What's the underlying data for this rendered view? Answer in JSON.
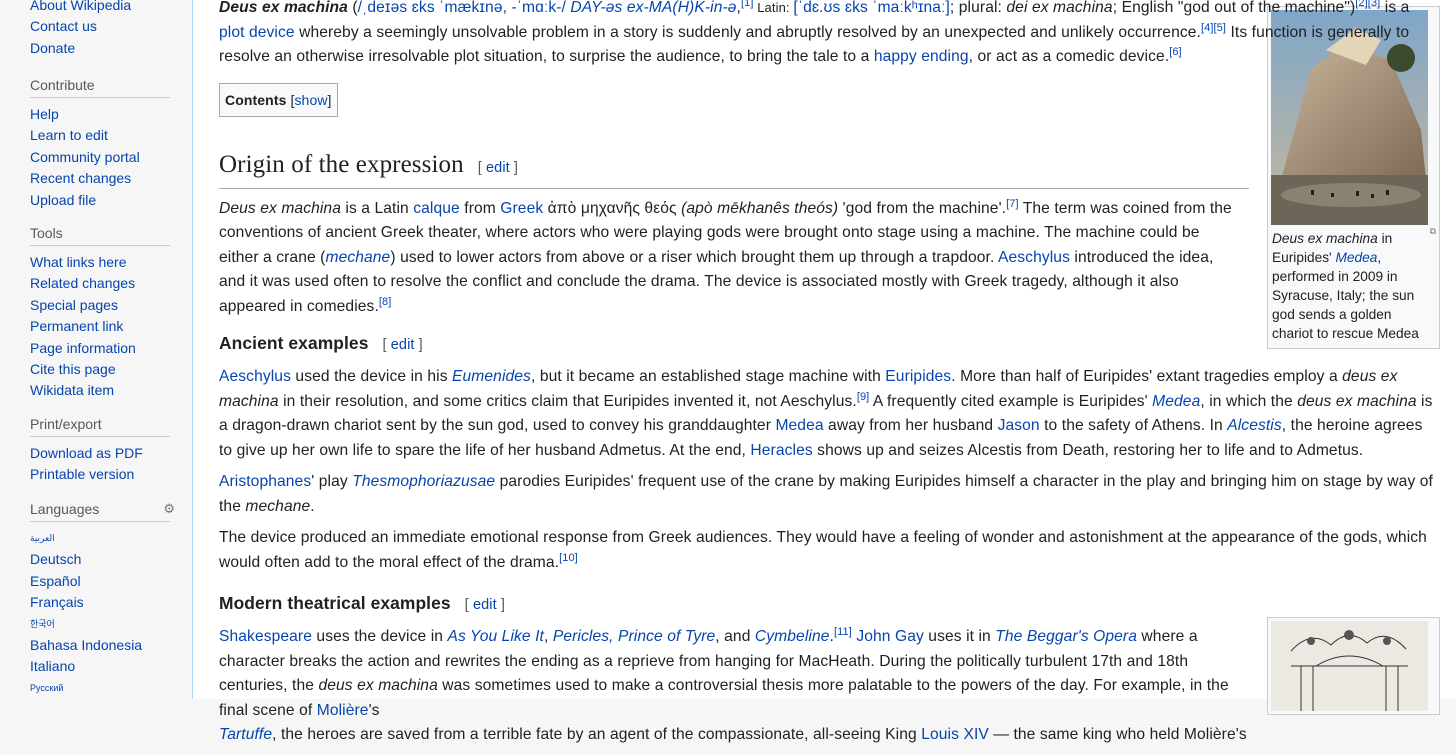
{
  "sidebar": {
    "nav_items": [
      "About Wikipedia",
      "Contact us",
      "Donate"
    ],
    "contribute": {
      "title": "Contribute",
      "items": [
        "Help",
        "Learn to edit",
        "Community portal",
        "Recent changes",
        "Upload file"
      ]
    },
    "tools": {
      "title": "Tools",
      "items": [
        "What links here",
        "Related changes",
        "Special pages",
        "Permanent link",
        "Page information",
        "Cite this page",
        "Wikidata item"
      ]
    },
    "print": {
      "title": "Print/export",
      "items": [
        "Download as PDF",
        "Printable version"
      ]
    },
    "languages": {
      "title": "Languages",
      "items": [
        "العربية",
        "Deutsch",
        "Español",
        "Français",
        "한국어",
        "Bahasa Indonesia",
        "Italiano",
        "Русский"
      ]
    }
  },
  "lead": {
    "term": "Deus ex machina",
    "p1a": " (",
    "ipa1": "/ˌdeɪəs ɛks ˈmækɪnə, -ˈmɑːk-/",
    "p1b": " ",
    "respell": "DAY-əs ex-MA(H)K-in-ə",
    "p1c": ",",
    "ref1": "[1]",
    "latin_label": " Latin: ",
    "ipa2": "[ˈdɛ.ʊs ɛks ˈmaːkʰɪnaː]",
    "p1d": "; plural: ",
    "plural": "dei ex machina",
    "p1e": "; English \"god out of the machine\")",
    "ref2": "[2]",
    "ref3": "[3]",
    "p1f": " is a ",
    "link_plot_device": "plot device",
    "p1g": " whereby a seemingly unsolvable problem in a story is suddenly and abruptly resolved by an unexpected and unlikely occurrence.",
    "ref4": "[4]",
    "ref5": "[5]",
    "p1h": " Its function is generally to resolve an otherwise irresolvable plot situation, to surprise the audience, to bring the tale to a ",
    "link_happy": "happy ending",
    "p1i": ", or act as a comedic device.",
    "ref6": "[6]"
  },
  "toc": {
    "title": "Contents",
    "toggle_prefix": " [",
    "toggle": "show",
    "toggle_suffix": "]"
  },
  "edit": {
    "open": "[ ",
    "label": "edit",
    "close": " ]"
  },
  "origin": {
    "heading": "Origin of the expression",
    "t_term": "Deus ex machina",
    "t1": " is a Latin ",
    "link_calque": "calque",
    "t2": " from ",
    "link_greek": "Greek",
    "t3": " ἀπὸ μηχανῆς θεός ",
    "translit": "(apò mēkhanês theós)",
    "t4": " 'god from the machine'.",
    "ref7": "[7]",
    "t5": " The term was coined from the conventions of ancient Greek theater, where actors who were playing gods were brought onto stage using a machine. The machine could be either a crane (",
    "link_mechane": "mechane",
    "t6": ") used to lower actors from above or a riser which brought them up through a trapdoor. ",
    "link_aeschylus": "Aeschylus",
    "t7": " introduced the idea, and it was used often to resolve the conflict and conclude the drama. The device is associated mostly with Greek tragedy, although it also appeared in comedies.",
    "ref8": "[8]"
  },
  "ancient": {
    "heading": "Ancient examples",
    "link_aeschylus": "Aeschylus",
    "a1": " used the device in his ",
    "link_eumenides": "Eumenides",
    "a2": ", but it became an established stage machine with ",
    "link_euripides": "Euripides",
    "a3": ". More than half of Euripides' extant tragedies employ a ",
    "a3i": "deus ex machina",
    "a4": " in their resolution, and some critics claim that Euripides invented it, not Aeschylus.",
    "ref9": "[9]",
    "a5": " A frequently cited example is Euripides' ",
    "link_medea_play": "Medea",
    "a6": ", in which the ",
    "a6i": "deus ex machina",
    "a7": " is a dragon-drawn chariot sent by the sun god, used to convey his granddaughter ",
    "link_medea": "Medea",
    "a8": " away from her husband ",
    "link_jason": "Jason",
    "a9": " to the safety of Athens. In ",
    "link_alcestis": "Alcestis",
    "a10": ", the heroine agrees to give up her own life to spare the life of her husband Admetus. At the end, ",
    "link_heracles": "Heracles",
    "a11": " shows up and seizes Alcestis from Death, restoring her to life and to Admetus.",
    "link_aristophanes": "Aristophanes",
    "b1": "' play ",
    "link_thesmo": "Thesmophoriazusae",
    "b2": " parodies Euripides' frequent use of the crane by making Euripides himself a character in the play and bringing him on stage by way of the ",
    "b2i": "mechane",
    "b3": ".",
    "c1": "The device produced an immediate emotional response from Greek audiences. They would have a feeling of wonder and astonishment at the appearance of the gods, which would often add to the moral effect of the drama.",
    "ref10": "[10]"
  },
  "modern": {
    "heading": "Modern theatrical examples",
    "link_shakespeare": "Shakespeare",
    "m1": " uses the device in ",
    "link_aylit": "As You Like It",
    "m2": ", ",
    "link_pericles": "Pericles, Prince of Tyre",
    "m3": ", and ",
    "link_cymbeline": "Cymbeline",
    "m4": ".",
    "ref11": "[11]",
    "m5": " ",
    "link_gay": "John Gay",
    "m6": " uses it in ",
    "link_beggars": "The Beggar's Opera",
    "m7": " where a character breaks the action and rewrites the ending as a reprieve from hanging for MacHeath. During the politically turbulent 17th and 18th centuries, the ",
    "m7i": "deus ex machina",
    "m8": " was sometimes used to make a controversial thesis more palatable to the powers of the day. For example, in the final scene of ",
    "link_moliere": "Molière",
    "m9": "'s",
    "link_tartuffe": "Tartuffe",
    "m10": ", the heroes are saved from a terrible fate by an agent of the compassionate, all-seeing King ",
    "link_louis": "Louis XIV",
    "m11": " — the same king who held Molière's"
  },
  "figure1": {
    "cap_i": "Deus ex machina",
    "cap1": " in Euripides' ",
    "cap_link": "Medea",
    "cap2": ", performed in 2009 in Syracuse, Italy; the sun god sends a golden chariot to rescue Medea"
  }
}
